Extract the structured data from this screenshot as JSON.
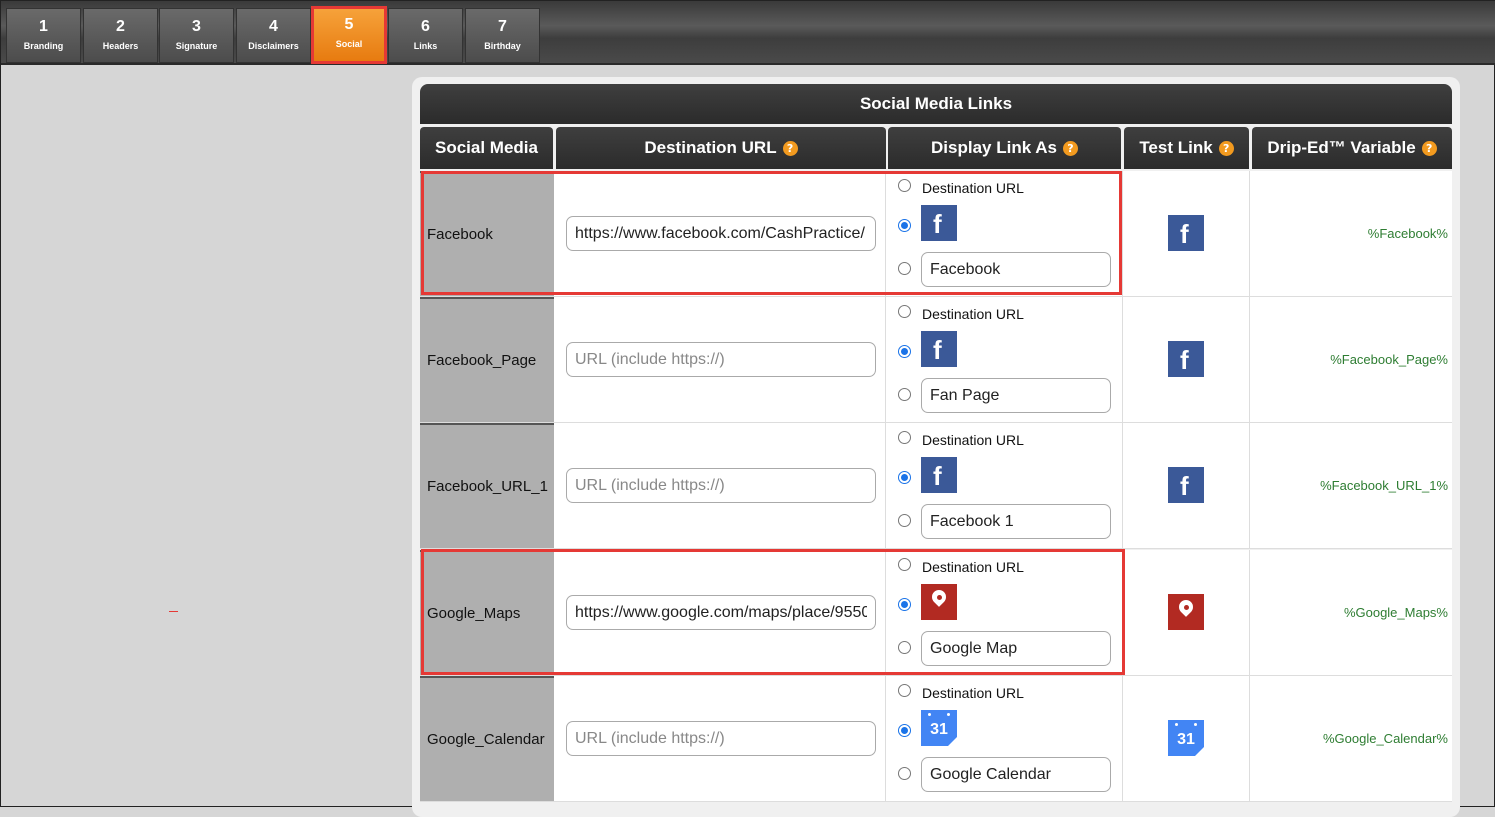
{
  "tabs": [
    {
      "num": "1",
      "label": "Branding"
    },
    {
      "num": "2",
      "label": "Headers"
    },
    {
      "num": "3",
      "label": "Signature"
    },
    {
      "num": "4",
      "label": "Disclaimers"
    },
    {
      "num": "5",
      "label": "Social",
      "active": true
    },
    {
      "num": "6",
      "label": "Links"
    },
    {
      "num": "7",
      "label": "Birthday"
    }
  ],
  "panel": {
    "title": "Social Media Links",
    "headers": {
      "social_media": "Social Media",
      "destination_url": "Destination URL",
      "display_link_as": "Display Link As",
      "test_link": "Test Link",
      "drip_variable": "Drip-Ed™ Variable"
    },
    "help_glyph": "?",
    "dest_option_label": "Destination URL"
  },
  "rows": [
    {
      "name": "Facebook",
      "url_value": "https://www.facebook.com/CashPractice/",
      "url_placeholder": "URL (include https://)",
      "icon": "facebook-icon",
      "icon_text": "f",
      "display_text": "Facebook",
      "variable": "%Facebook%"
    },
    {
      "name": "Facebook_Page",
      "url_value": "",
      "url_placeholder": "URL (include https://)",
      "icon": "facebook-icon",
      "icon_text": "f",
      "display_text": "Fan Page",
      "variable": "%Facebook_Page%"
    },
    {
      "name": "Facebook_URL_1",
      "url_value": "",
      "url_placeholder": "URL (include https://)",
      "icon": "facebook-icon",
      "icon_text": "f",
      "display_text": "Facebook 1",
      "variable": "%Facebook_URL_1%"
    },
    {
      "name": "Google_Maps",
      "url_value": "https://www.google.com/maps/place/9550",
      "url_placeholder": "URL (include https://)",
      "icon": "map-pin-icon",
      "icon_text": "",
      "display_text": "Google Map",
      "variable": "%Google_Maps%"
    },
    {
      "name": "Google_Calendar",
      "url_value": "",
      "url_placeholder": "URL (include https://)",
      "icon": "calendar-icon",
      "icon_text": "31",
      "display_text": "Google Calendar",
      "variable": "%Google_Calendar%"
    }
  ],
  "colors": {
    "accent_orange": "#f29a1f",
    "highlight_red": "#e53935",
    "variable_green": "#2e7d32",
    "facebook_blue": "#3b5998",
    "maps_red": "#b22a22",
    "calendar_blue": "#4285f4"
  }
}
